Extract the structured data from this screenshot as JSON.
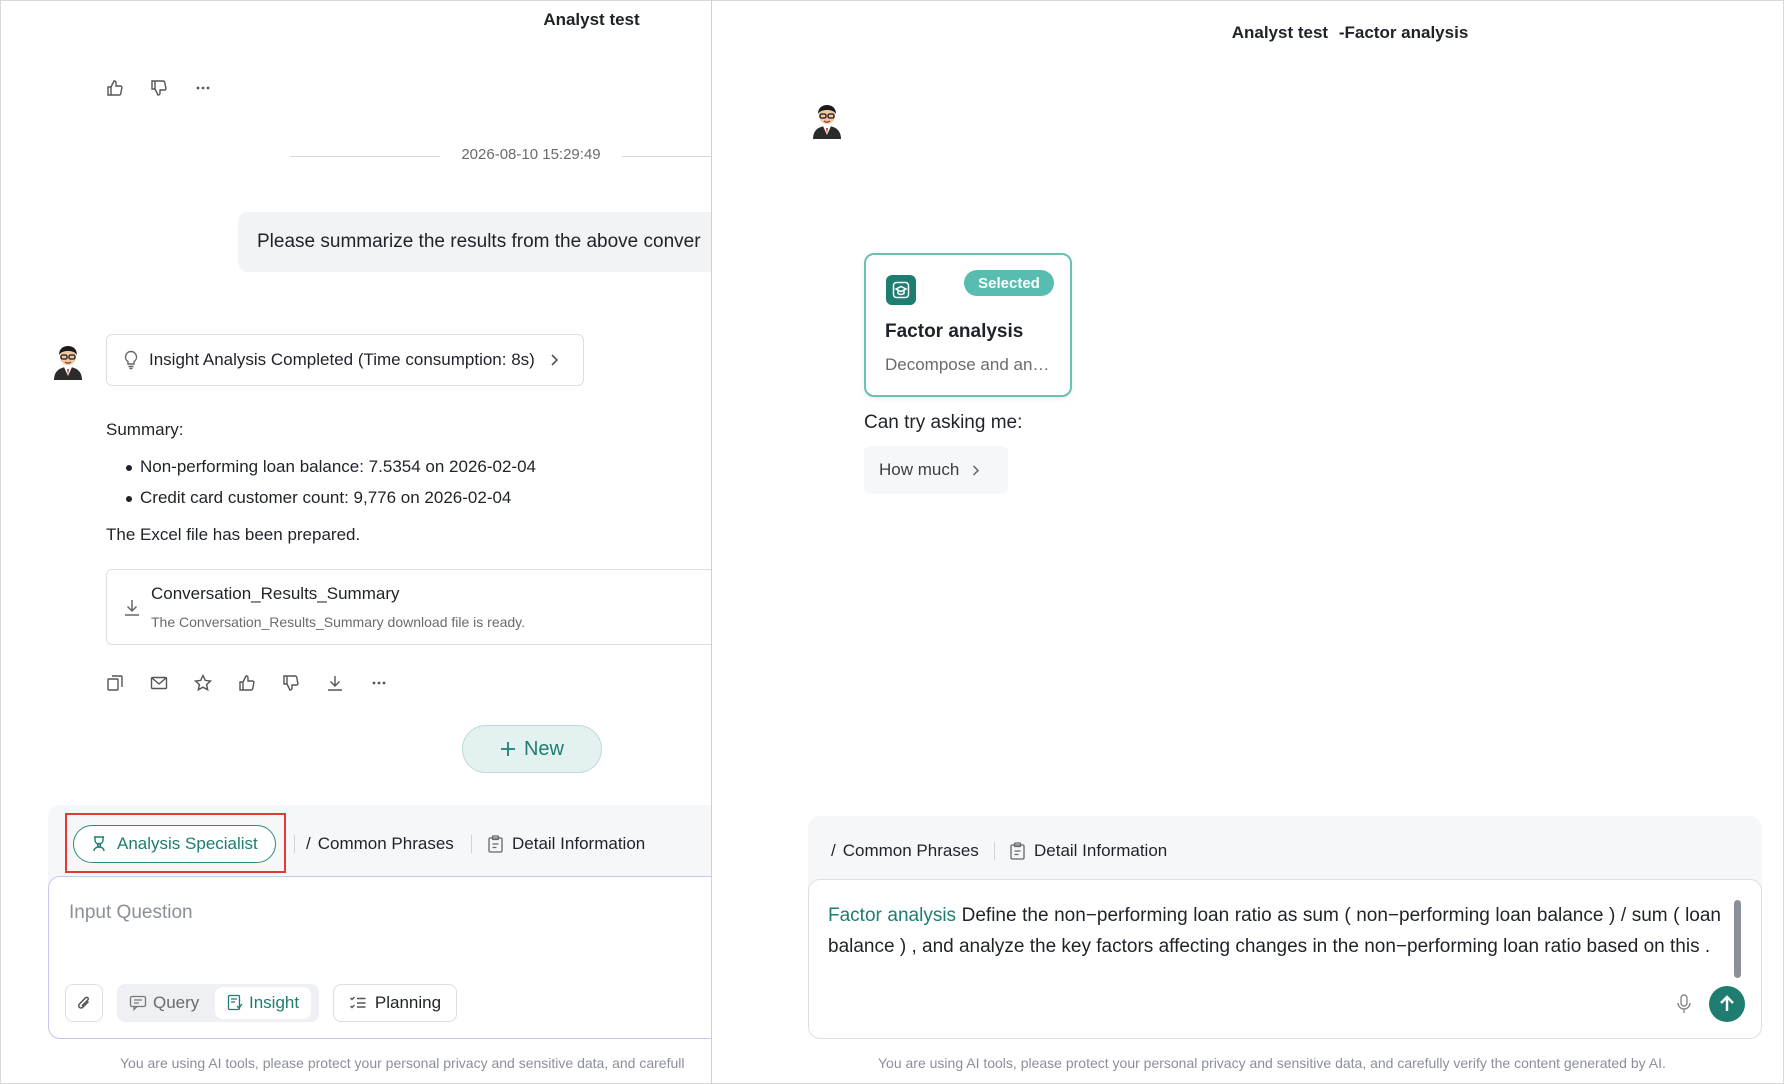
{
  "left": {
    "title": "Analyst test",
    "timestamp": "2026-08-10 15:29:49",
    "user_message": "Please summarize the results from the above conver",
    "insight_status": "Insight Analysis Completed (Time consumption: 8s)",
    "summary_label": "Summary:",
    "bullets": [
      "Non-performing loan balance: 7.5354 on 2026-02-04",
      "Credit card customer count: 9,776 on 2026-02-04"
    ],
    "excel_note": "The Excel file has been prepared.",
    "file": {
      "title": "Conversation_Results_Summary",
      "subtitle": "The Conversation_Results_Summary download file is ready."
    },
    "new_button": "New",
    "toolbar": {
      "specialist": "Analysis Specialist",
      "common_phrases": "Common Phrases",
      "detail_information": "Detail Information"
    },
    "input_placeholder": "Input Question",
    "modes": {
      "query": "Query",
      "insight": "Insight"
    },
    "planning": "Planning",
    "disclaimer": "You are using AI tools, please protect your personal privacy and sensitive data, and carefull"
  },
  "right": {
    "title_main": "Analyst test",
    "title_sub": "-Factor analysis",
    "skill_card": {
      "badge": "Selected",
      "name": "Factor analysis",
      "description": "Decompose and an…"
    },
    "try_label": "Can try asking me:",
    "suggestion": "How much",
    "toolbar": {
      "common_phrases": "Common Phrases",
      "detail_information": "Detail Information"
    },
    "input_tag": "Factor analysis",
    "input_text": "Define the non−performing loan ratio as sum ( non−performing loan balance ) / sum ( loan balance ) , and analyze the key factors affecting changes in the non−performing loan ratio based on this .",
    "disclaimer": "You are using AI tools, please protect your personal privacy and sensitive data, and carefully verify the content generated by AI."
  },
  "colors": {
    "accent": "#1e7d70",
    "badge": "#57bdb0",
    "highlight_box": "#e53935",
    "bubble_bg": "#f2f3f5"
  }
}
